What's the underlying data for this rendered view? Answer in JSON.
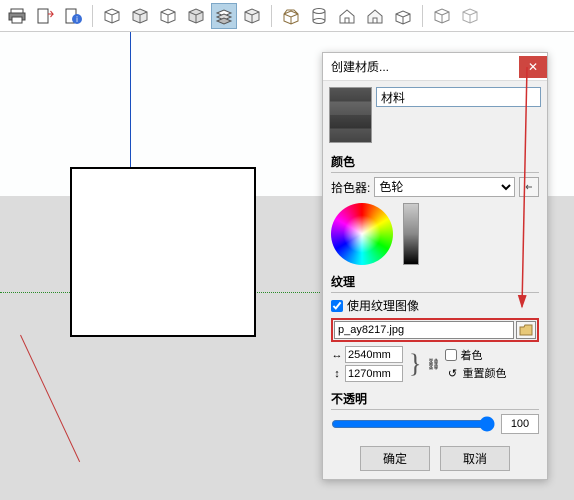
{
  "dialog": {
    "title": "创建材质...",
    "name_value": "材料",
    "color_section": "颜色",
    "picker_label": "拾色器:",
    "picker_value": "色轮",
    "texture_section": "纹理",
    "use_texture_label": "使用纹理图像",
    "texture_file": "p_ay8217.jpg",
    "width_value": "2540mm",
    "height_value": "1270mm",
    "colorize_label": "着色",
    "reset_color_label": "重置颜色",
    "opacity_section": "不透明",
    "opacity_value": "100",
    "ok": "确定",
    "cancel": "取消"
  }
}
